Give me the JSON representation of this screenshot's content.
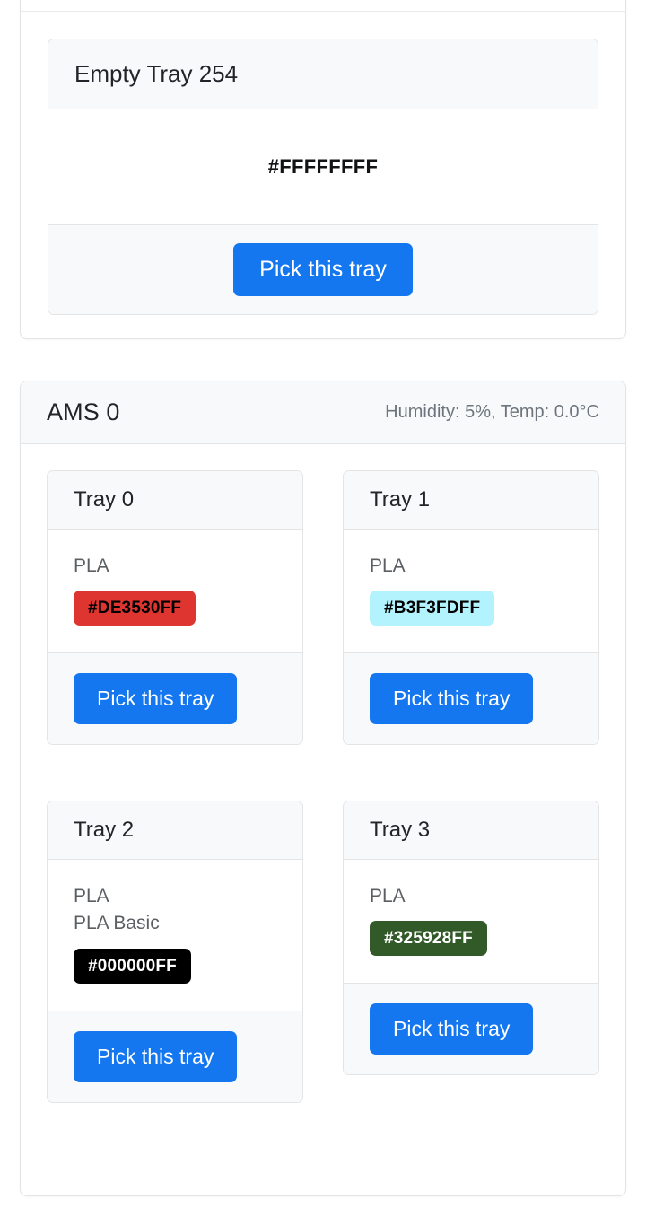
{
  "empty_tray_panel": {
    "card": {
      "title": "Empty Tray 254",
      "color_hex": "#FFFFFFFF",
      "pick_label": "Pick this tray"
    }
  },
  "ams_panel": {
    "title": "AMS 0",
    "status": "Humidity: 5%, Temp: 0.0°C",
    "humidity": "5%",
    "temperature": "0.0°C",
    "trays": [
      {
        "title": "Tray 0",
        "material": "PLA",
        "sub_material": "",
        "color_hex": "#DE3530FF",
        "swatch_bg": "#DE3530",
        "swatch_fg": "#000000",
        "pick_label": "Pick this tray"
      },
      {
        "title": "Tray 1",
        "material": "PLA",
        "sub_material": "",
        "color_hex": "#B3F3FDFF",
        "swatch_bg": "#B3F3FD",
        "swatch_fg": "#000000",
        "pick_label": "Pick this tray"
      },
      {
        "title": "Tray 2",
        "material": "PLA",
        "sub_material": "PLA Basic",
        "color_hex": "#000000FF",
        "swatch_bg": "#000000",
        "swatch_fg": "#FFFFFF",
        "pick_label": "Pick this tray"
      },
      {
        "title": "Tray 3",
        "material": "PLA",
        "sub_material": "",
        "color_hex": "#325928FF",
        "swatch_bg": "#325928",
        "swatch_fg": "#FFFFFF",
        "pick_label": "Pick this tray"
      }
    ]
  },
  "theme": {
    "accent_blue": "#1477f0",
    "header_bg": "#f8f9fa",
    "border": "#e3e4e6",
    "muted_text": "#6c757d"
  }
}
